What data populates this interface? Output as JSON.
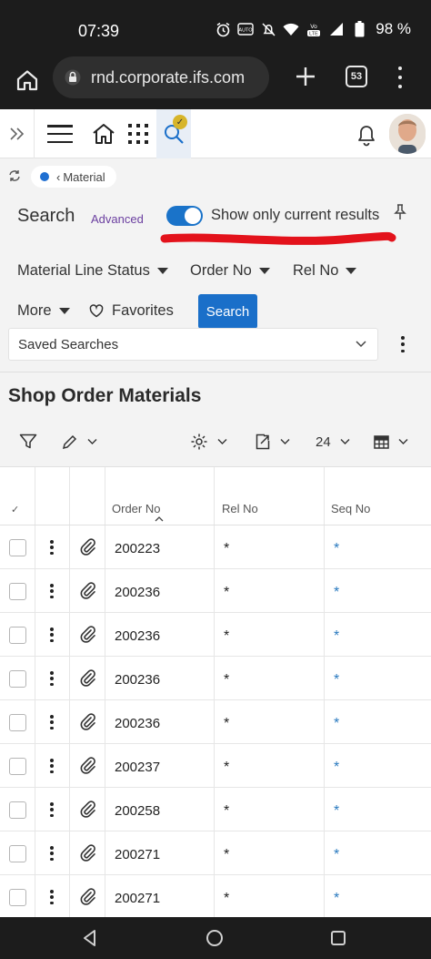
{
  "status_bar": {
    "time": "07:39",
    "battery": "98 %",
    "icons": [
      "alarm-icon",
      "auto-brightness-icon",
      "do-not-disturb-icon",
      "wifi-icon",
      "volte-icon",
      "signal-icon",
      "battery-icon"
    ]
  },
  "browser": {
    "url": "rnd.corporate.ifs.com",
    "tab_count": "53"
  },
  "topnav": {
    "icons": [
      "expand-icon",
      "hamburger-menu-icon",
      "home-icon",
      "apps-grid-icon",
      "search-icon",
      "notification-bell-icon",
      "user-avatar"
    ]
  },
  "breadcrumb": {
    "label": "Material"
  },
  "search": {
    "title": "Search",
    "advanced_label": "Advanced",
    "toggle_label": "Show only current results",
    "toggle_on": true,
    "filters": [
      "Material Line Status",
      "Order No",
      "Rel No",
      "More"
    ],
    "favorites_label": "Favorites",
    "search_button": "Search",
    "saved_searches": "Saved Searches"
  },
  "page": {
    "title": "Shop Order Materials",
    "page_size": "24"
  },
  "table": {
    "columns": [
      "Order No",
      "Rel No",
      "Seq No"
    ],
    "rows": [
      {
        "order_no": "200223",
        "rel_no": "*",
        "seq_no": "*"
      },
      {
        "order_no": "200236",
        "rel_no": "*",
        "seq_no": "*"
      },
      {
        "order_no": "200236",
        "rel_no": "*",
        "seq_no": "*"
      },
      {
        "order_no": "200236",
        "rel_no": "*",
        "seq_no": "*"
      },
      {
        "order_no": "200236",
        "rel_no": "*",
        "seq_no": "*"
      },
      {
        "order_no": "200237",
        "rel_no": "*",
        "seq_no": "*"
      },
      {
        "order_no": "200258",
        "rel_no": "*",
        "seq_no": "*"
      },
      {
        "order_no": "200271",
        "rel_no": "*",
        "seq_no": "*"
      },
      {
        "order_no": "200271",
        "rel_no": "*",
        "seq_no": "*"
      }
    ]
  },
  "colors": {
    "accent": "#1a6fc9",
    "toggle": "#1a73c9",
    "advanced_link": "#6b3fa0",
    "annotation_underline": "#e3121b",
    "notification_badge": "#d7b52a",
    "seq_link": "#2a7abf"
  }
}
